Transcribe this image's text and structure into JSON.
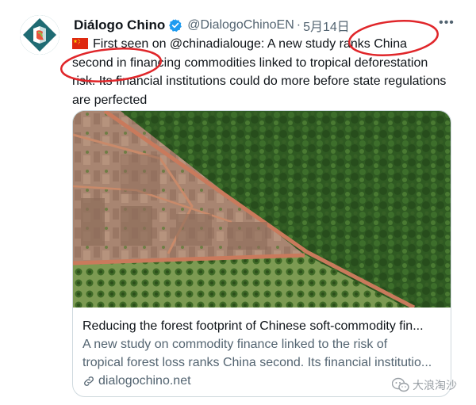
{
  "tweet": {
    "display_name": "Diálogo Chino",
    "handle": "@DialogoChinoEN",
    "separator": "·",
    "date": "5月14日",
    "more_label": "•••",
    "text_lead": "First seen on @chinadialouge: A new study ranks China second in financing commodities linked to tropical deforestation risk. Its financial institutions could do more before state regulations are perfected",
    "icons": {
      "avatar": "dialogo-chino-logo",
      "verified": "verified-badge-icon",
      "flag": "china-flag-icon",
      "more": "more-options-icon",
      "link": "link-icon"
    }
  },
  "card": {
    "title": "Reducing the forest footprint of Chinese soft-commodity fin...",
    "description_line1": "A new study on commodity finance linked to the risk of",
    "description_line2": "tropical forest loss ranks China second. Its financial institutio...",
    "domain": "dialogochino.net"
  },
  "watermark": {
    "text": "大浪淘沙"
  },
  "colors": {
    "verified": "#1d9bf0",
    "annotation_red": "#e0262a",
    "secondary_text": "#536471",
    "border": "#cfd9de"
  }
}
